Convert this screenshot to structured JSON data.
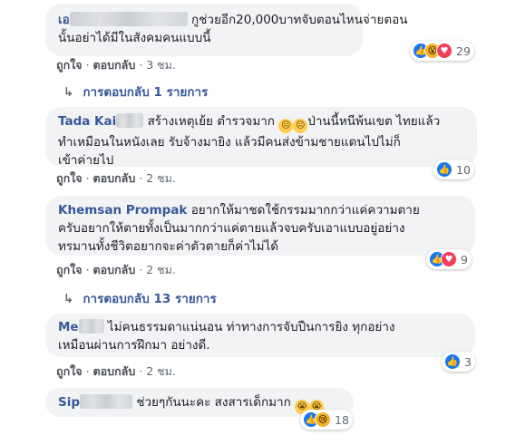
{
  "action_like": "ถูกใจ",
  "action_reply": "ตอบกลับ",
  "sep": "·",
  "comments": [
    {
      "name": "เอ",
      "lines": [
        "กูช่วยอีก20,000บาทจับตอนไหนจ่ายตอน",
        "นั้นอย่าได้มีในสังคมคนแบบนี้"
      ],
      "time": "3 ชม.",
      "reaction_count": "29",
      "reaction_icons": [
        "like-icon",
        "wow-icon",
        "love-icon"
      ]
    },
    {
      "name": "Tada Kai",
      "lines": [
        "สร้างเหตุเย้ย ตำรวจมาก",
        "ป่านนี้หนีพ้นเขต ไทยแล้ว",
        "ทำเหมือนในหนังเลย รับจ้างมายิง แล้วมีคนส่งข้ามชายแดนไปไม่ก็",
        "เข้าค่ายไป"
      ],
      "time": "2 ชม.",
      "reaction_count": "10",
      "reaction_icons": [
        "like-icon"
      ]
    },
    {
      "name": "Khemsan Prompak",
      "lines": [
        "อยากให้มาชดใช้กรรมมากกว่าแค่ความตาย",
        "ครับอยากให้ตายทั้งเป็นมากกว่าแค่ตายแล้วจบครับเอาแบบอยู่อย่าง",
        "ทรมานทั้งชีวิตอยากจะค่าตัวตายก็ค่าไม่ได้"
      ],
      "time": "2 ชม.",
      "reaction_count": "9",
      "reaction_icons": [
        "like-icon",
        "love-icon"
      ]
    },
    {
      "name": "Me",
      "lines": [
        "ไม่คนธรรมดาแน่นอน ท่าทางการจับปืนการยิง ทุกอย่าง",
        "เหมือนผ่านการฝึกมา อย่างดี."
      ],
      "time": "2 ชม.",
      "reaction_count": "3",
      "reaction_icons": [
        "like-icon"
      ]
    },
    {
      "name": "Sip",
      "lines": [
        "ช่วยๆกันนะคะ สงสารเด็กมาก"
      ],
      "time": "",
      "reaction_count": "18",
      "reaction_icons": [
        "like-icon",
        "sad-icon"
      ]
    }
  ],
  "replies": [
    {
      "text": "การตอบกลับ 1 รายการ"
    },
    {
      "text": "การตอบกลับ 13 รายการ"
    }
  ]
}
